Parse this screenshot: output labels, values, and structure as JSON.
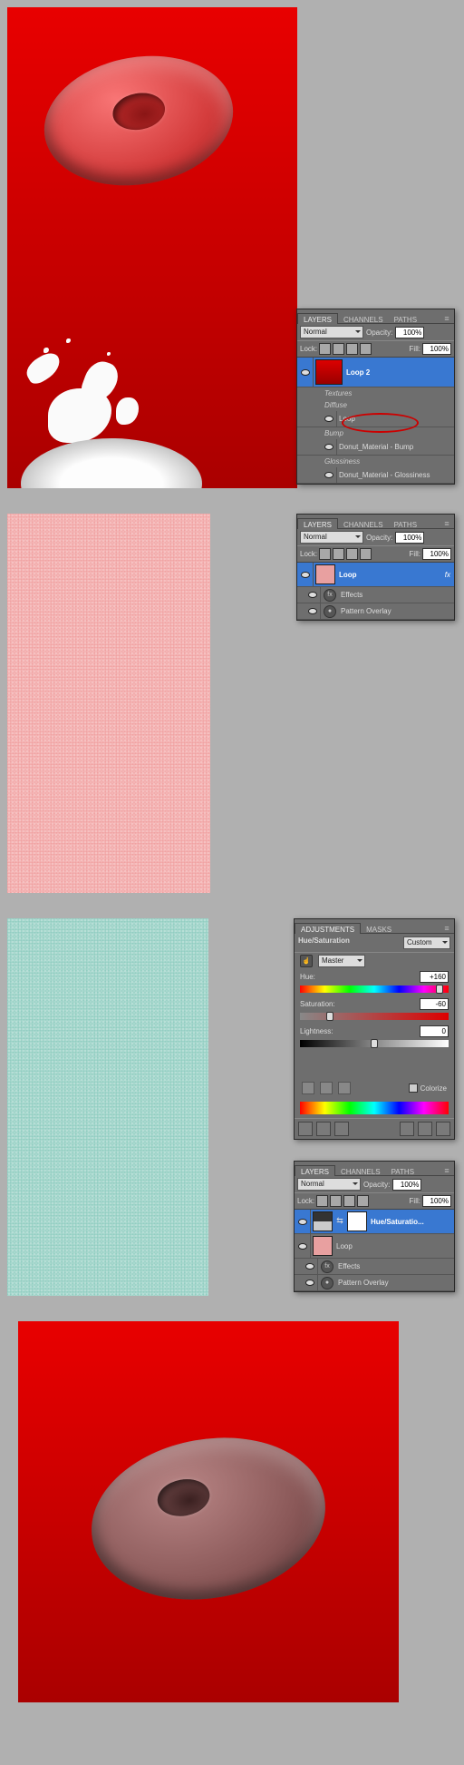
{
  "step1": {
    "tabs": {
      "layers": "LAYERS",
      "channels": "CHANNELS",
      "paths": "PATHS"
    },
    "blend_mode": "Normal",
    "opacity_label": "Opacity:",
    "opacity": "100%",
    "lock_label": "Lock:",
    "fill_label": "Fill:",
    "fill": "100%",
    "layer_sel": "Loop 2",
    "group_textures": "Textures",
    "group_diffuse": "Diffuse",
    "layer_loop": "Loop",
    "group_bump": "Bump",
    "layer_bump": "Donut_Material - Bump",
    "group_gloss": "Glossiness",
    "layer_gloss": "Donut_Material - Glossiness"
  },
  "step2": {
    "tabs": {
      "layers": "LAYERS",
      "channels": "CHANNELS",
      "paths": "PATHS"
    },
    "blend_mode": "Normal",
    "opacity_label": "Opacity:",
    "opacity": "100%",
    "lock_label": "Lock:",
    "fill_label": "Fill:",
    "fill": "100%",
    "layer_sel": "Loop",
    "fx": "fx",
    "effects": "Effects",
    "pattern_overlay": "Pattern Overlay"
  },
  "step3": {
    "adj": {
      "tabs": {
        "adjustments": "ADJUSTMENTS",
        "masks": "MASKS"
      },
      "title": "Hue/Saturation",
      "preset": "Custom",
      "channel": "Master",
      "hue_label": "Hue:",
      "hue": "+160",
      "sat_label": "Saturation:",
      "sat": "-60",
      "lig_label": "Lightness:",
      "lig": "0",
      "colorize": "Colorize"
    },
    "layers": {
      "tabs": {
        "layers": "LAYERS",
        "channels": "CHANNELS",
        "paths": "PATHS"
      },
      "blend_mode": "Normal",
      "opacity_label": "Opacity:",
      "opacity": "100%",
      "lock_label": "Lock:",
      "fill_label": "Fill:",
      "fill": "100%",
      "layer_sel": "Hue/Saturatio...",
      "layer_loop": "Loop",
      "effects": "Effects",
      "pattern_overlay": "Pattern Overlay"
    }
  }
}
